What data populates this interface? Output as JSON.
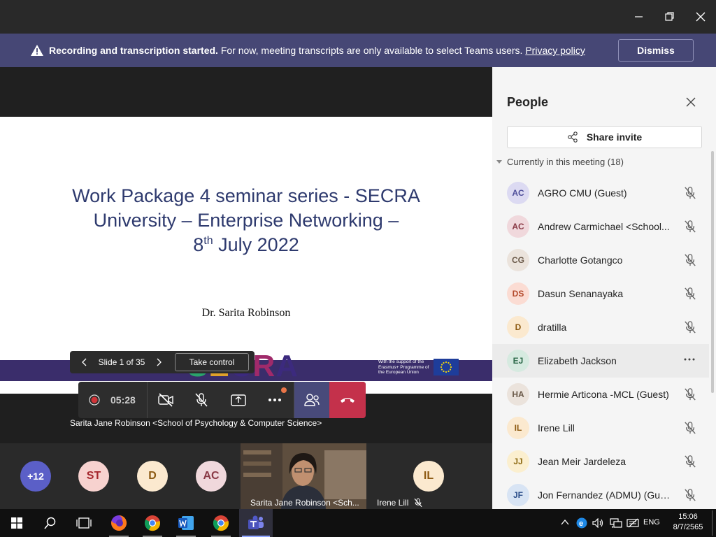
{
  "banner": {
    "bold": "Recording and transcription started.",
    "text": " For now, meeting transcripts are only available to select Teams users. ",
    "link": "Privacy policy",
    "dismiss": "Dismiss"
  },
  "slide": {
    "line1": "Work Package 4 seminar series -  SECRA",
    "line2": "University – Enterprise Networking –",
    "line3_pre": "8",
    "line3_sup": "th",
    "line3_post": " July 2022",
    "author": "Dr. Sarita Robinson",
    "logo": "SECRA",
    "eu_text": "With the support of the Erasmus+ Programme of the European Union"
  },
  "slide_nav": {
    "count": "Slide 1 of 35",
    "take_control": "Take control"
  },
  "controls": {
    "timer": "05:28"
  },
  "presenter_label": "Sarita Jane Robinson <School of Psychology & Computer Science>",
  "gallery": {
    "avatars": [
      "+12",
      "ST",
      "D",
      "AC",
      "IL"
    ],
    "video_label": "Sarita Jane Robinson <Sch...",
    "irene_label": "Irene Lill"
  },
  "panel": {
    "title": "People",
    "share_invite": "Share invite",
    "section": "Currently in this meeting",
    "section_count": "(18)",
    "people": [
      {
        "initials": "AC",
        "name": "AGRO CMU (Guest)",
        "color": "#dcdaf2",
        "fg": "#4f4f9a"
      },
      {
        "initials": "AC",
        "name": "Andrew Carmichael <School...",
        "color": "#f0d8dc",
        "fg": "#8a3a46"
      },
      {
        "initials": "CG",
        "name": "Charlotte Gotangco",
        "color": "#ebe3dc",
        "fg": "#6b5a4a"
      },
      {
        "initials": "DS",
        "name": "Dasun Senanayaka",
        "color": "#fbdcd3",
        "fg": "#b44a2c"
      },
      {
        "initials": "D",
        "name": "dratilla",
        "color": "#fbe9cf",
        "fg": "#8d5a12"
      },
      {
        "initials": "EJ",
        "name": "Elizabeth Jackson",
        "color": "#d6eae0",
        "fg": "#2d6a4a"
      },
      {
        "initials": "HA",
        "name": "Hermie Articona -MCL (Guest)",
        "color": "#ebe3dc",
        "fg": "#6b5a4a"
      },
      {
        "initials": "IL",
        "name": "Irene Lill",
        "color": "#fbe9cf",
        "fg": "#8d5a12"
      },
      {
        "initials": "JJ",
        "name": "Jean Meir Jardeleza",
        "color": "#fbefcf",
        "fg": "#8d6a12"
      },
      {
        "initials": "JF",
        "name": "Jon Fernandez (ADMU) (Gue...",
        "color": "#d8e4f4",
        "fg": "#2d4f8a"
      }
    ]
  },
  "taskbar": {
    "lang": "ENG",
    "time": "15:06",
    "date": "8/7/2565"
  }
}
